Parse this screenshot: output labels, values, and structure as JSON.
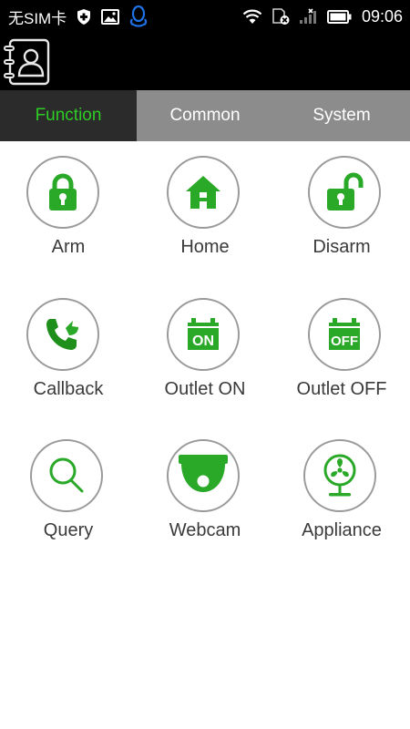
{
  "status_bar": {
    "carrier": "无SIM卡",
    "time": "09:06",
    "icons": [
      "shield-plus-icon",
      "image-icon",
      "qq-penguin-icon",
      "wifi-icon",
      "sim-blocked-icon",
      "signal-icon",
      "battery-icon"
    ]
  },
  "header": {
    "contacts_icon": "contacts-book-icon"
  },
  "tabs": [
    {
      "label": "Function",
      "active": true
    },
    {
      "label": "Common",
      "active": false
    },
    {
      "label": "System",
      "active": false
    }
  ],
  "functions": [
    {
      "label": "Arm",
      "icon": "lock-closed-icon"
    },
    {
      "label": "Home",
      "icon": "house-icon"
    },
    {
      "label": "Disarm",
      "icon": "lock-open-icon"
    },
    {
      "label": "Callback",
      "icon": "phone-callback-icon"
    },
    {
      "label": "Outlet ON",
      "icon": "outlet-on-icon",
      "badge": "ON"
    },
    {
      "label": "Outlet OFF",
      "icon": "outlet-off-icon",
      "badge": "OFF"
    },
    {
      "label": "Query",
      "icon": "search-icon"
    },
    {
      "label": "Webcam",
      "icon": "webcam-icon"
    },
    {
      "label": "Appliance",
      "icon": "fan-icon"
    }
  ],
  "colors": {
    "accent_green": "#2aa827",
    "tab_active_text": "#2ecc25",
    "tab_active_bg": "#2b2b2b",
    "tab_inactive_bg": "#8c8c8c"
  }
}
